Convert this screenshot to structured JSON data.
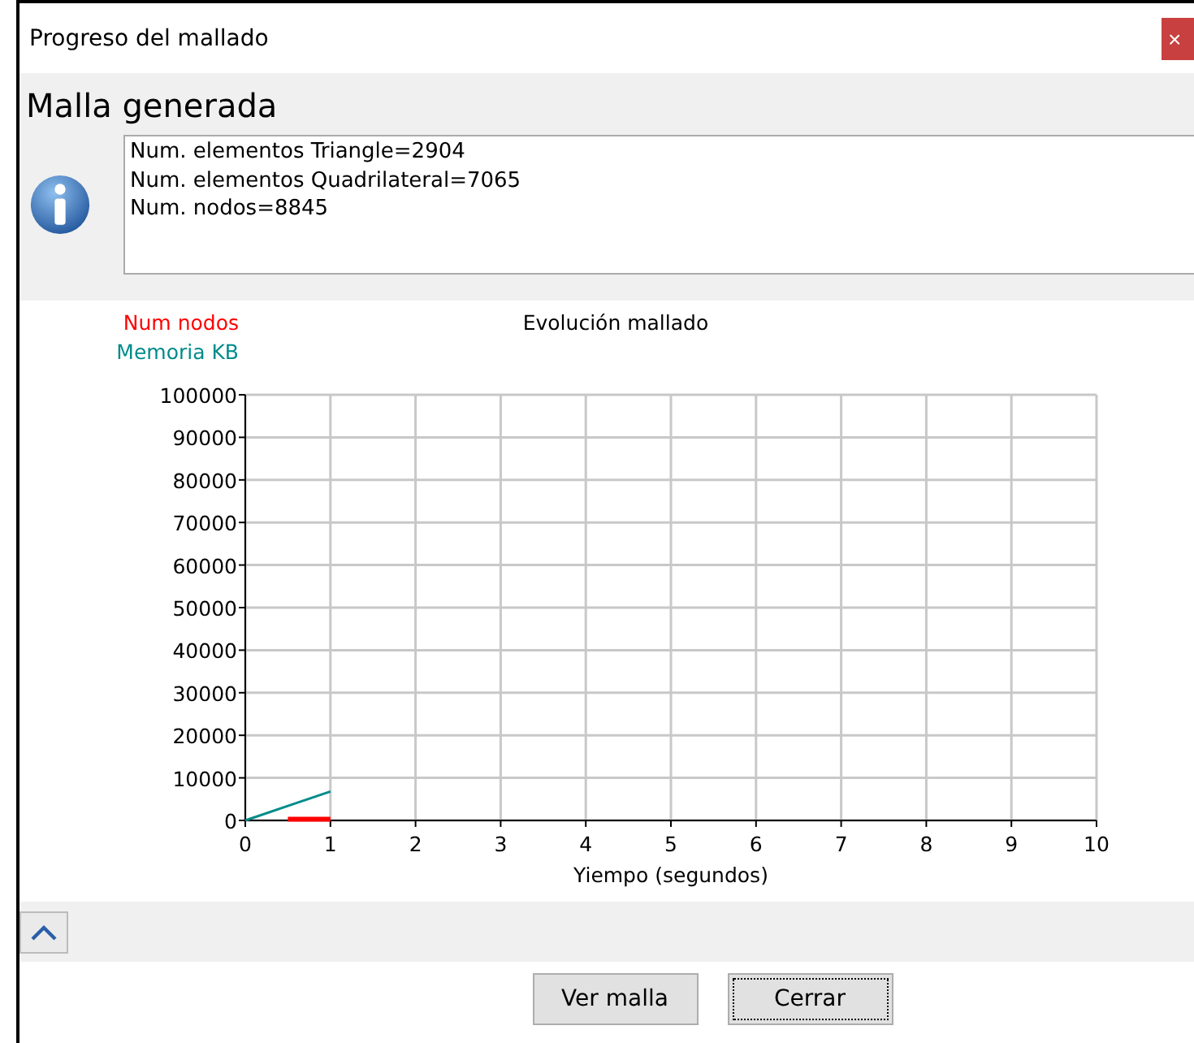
{
  "window": {
    "title": "Progreso del mallado",
    "close": "×"
  },
  "heading": "Malla generada",
  "message": [
    "Num. elementos Triangle=2904",
    "Num. elementos Quadrilateral=7065",
    "Num. nodos=8845"
  ],
  "chart": {
    "chart_data": {
      "type": "line",
      "title": "Evolución mallado",
      "xlabel": "Yiempo (segundos)",
      "x": [
        0,
        0.5,
        1
      ],
      "series": [
        {
          "name": "Num nodos",
          "color": "#ff0000",
          "values": [
            null,
            300,
            300
          ]
        },
        {
          "name": "Memoria KB",
          "color": "#008b8b",
          "values": [
            0,
            3400,
            6800
          ]
        }
      ],
      "grid": true,
      "xlim": [
        0,
        10
      ],
      "ylim": [
        0,
        100000
      ],
      "xticks": [
        0,
        1,
        2,
        3,
        4,
        5,
        6,
        7,
        8,
        9,
        10
      ],
      "yticks": [
        0,
        10000,
        20000,
        30000,
        40000,
        50000,
        60000,
        70000,
        80000,
        90000,
        100000
      ]
    }
  },
  "collapse": {
    "expanded": true
  },
  "buttons": [
    {
      "label": "Ver malla",
      "focused": false
    },
    {
      "label": "Cerrar",
      "focused": true
    }
  ]
}
